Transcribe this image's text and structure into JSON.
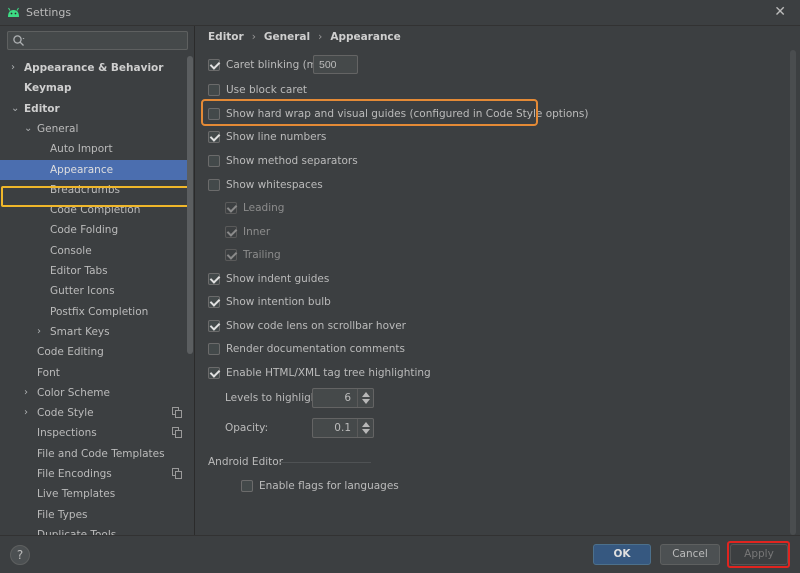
{
  "window": {
    "title": "Settings",
    "close_label": "✕"
  },
  "search": {
    "value": "",
    "placeholder": ""
  },
  "sidebar": {
    "items": [
      {
        "label": "Appearance & Behavior",
        "bold": true,
        "arrow": "›",
        "indent": 0
      },
      {
        "label": "Keymap",
        "bold": true,
        "arrow": "",
        "indent": 0
      },
      {
        "label": "Editor",
        "bold": true,
        "arrow": "⌄",
        "indent": 0
      },
      {
        "label": "General",
        "bold": false,
        "arrow": "⌄",
        "indent": 1
      },
      {
        "label": "Auto Import",
        "bold": false,
        "arrow": "",
        "indent": 2
      },
      {
        "label": "Appearance",
        "bold": false,
        "arrow": "",
        "indent": 2,
        "selected": true
      },
      {
        "label": "Breadcrumbs",
        "bold": false,
        "arrow": "",
        "indent": 2
      },
      {
        "label": "Code Completion",
        "bold": false,
        "arrow": "",
        "indent": 2
      },
      {
        "label": "Code Folding",
        "bold": false,
        "arrow": "",
        "indent": 2
      },
      {
        "label": "Console",
        "bold": false,
        "arrow": "",
        "indent": 2
      },
      {
        "label": "Editor Tabs",
        "bold": false,
        "arrow": "",
        "indent": 2
      },
      {
        "label": "Gutter Icons",
        "bold": false,
        "arrow": "",
        "indent": 2
      },
      {
        "label": "Postfix Completion",
        "bold": false,
        "arrow": "",
        "indent": 2
      },
      {
        "label": "Smart Keys",
        "bold": false,
        "arrow": "›",
        "indent": 2
      },
      {
        "label": "Code Editing",
        "bold": false,
        "arrow": "",
        "indent": 1
      },
      {
        "label": "Font",
        "bold": false,
        "arrow": "",
        "indent": 1
      },
      {
        "label": "Color Scheme",
        "bold": false,
        "arrow": "›",
        "indent": 1
      },
      {
        "label": "Code Style",
        "bold": false,
        "arrow": "›",
        "indent": 1,
        "copy": true
      },
      {
        "label": "Inspections",
        "bold": false,
        "arrow": "",
        "indent": 1,
        "copy": true
      },
      {
        "label": "File and Code Templates",
        "bold": false,
        "arrow": "",
        "indent": 1
      },
      {
        "label": "File Encodings",
        "bold": false,
        "arrow": "",
        "indent": 1,
        "copy": true
      },
      {
        "label": "Live Templates",
        "bold": false,
        "arrow": "",
        "indent": 1
      },
      {
        "label": "File Types",
        "bold": false,
        "arrow": "",
        "indent": 1
      },
      {
        "label": "Duplicate Tools",
        "bold": false,
        "arrow": "",
        "indent": 1
      }
    ]
  },
  "breadcrumb": {
    "part1": "Editor",
    "part2": "General",
    "part3": "Appearance",
    "sep": "›"
  },
  "options": {
    "caret_blinking": {
      "label": "Caret blinking (ms):",
      "checked": true,
      "value": "500"
    },
    "block_caret": {
      "label": "Use block caret",
      "checked": false
    },
    "hard_wrap": {
      "label": "Show hard wrap and visual guides (configured in Code Style options)",
      "checked": false
    },
    "line_numbers": {
      "label": "Show line numbers",
      "checked": true
    },
    "method_separators": {
      "label": "Show method separators",
      "checked": false
    },
    "whitespaces": {
      "label": "Show whitespaces",
      "checked": false
    },
    "leading": {
      "label": "Leading",
      "checked": true,
      "disabled": true
    },
    "inner": {
      "label": "Inner",
      "checked": true,
      "disabled": true
    },
    "trailing": {
      "label": "Trailing",
      "checked": true,
      "disabled": true
    },
    "indent_guides": {
      "label": "Show indent guides",
      "checked": true
    },
    "intention_bulb": {
      "label": "Show intention bulb",
      "checked": true
    },
    "code_lens": {
      "label": "Show code lens on scrollbar hover",
      "checked": true
    },
    "render_docs": {
      "label": "Render documentation comments",
      "checked": false
    },
    "html_xml": {
      "label": "Enable HTML/XML tag tree highlighting",
      "checked": true
    },
    "levels": {
      "label": "Levels to highlight:",
      "value": "6"
    },
    "opacity": {
      "label": "Opacity:",
      "value": "0.1"
    }
  },
  "android": {
    "section_title": "Android Editor",
    "enable_flags": {
      "label": "Enable flags for languages",
      "checked": false
    }
  },
  "footer": {
    "help": "?",
    "ok": "OK",
    "cancel": "Cancel",
    "apply": "Apply"
  },
  "colors": {
    "selection": "#4b6eaf",
    "highlight_yellow": "#f0b72a",
    "highlight_orange": "#e48a36",
    "highlight_red": "#e0241f",
    "ok_button": "#365880"
  }
}
